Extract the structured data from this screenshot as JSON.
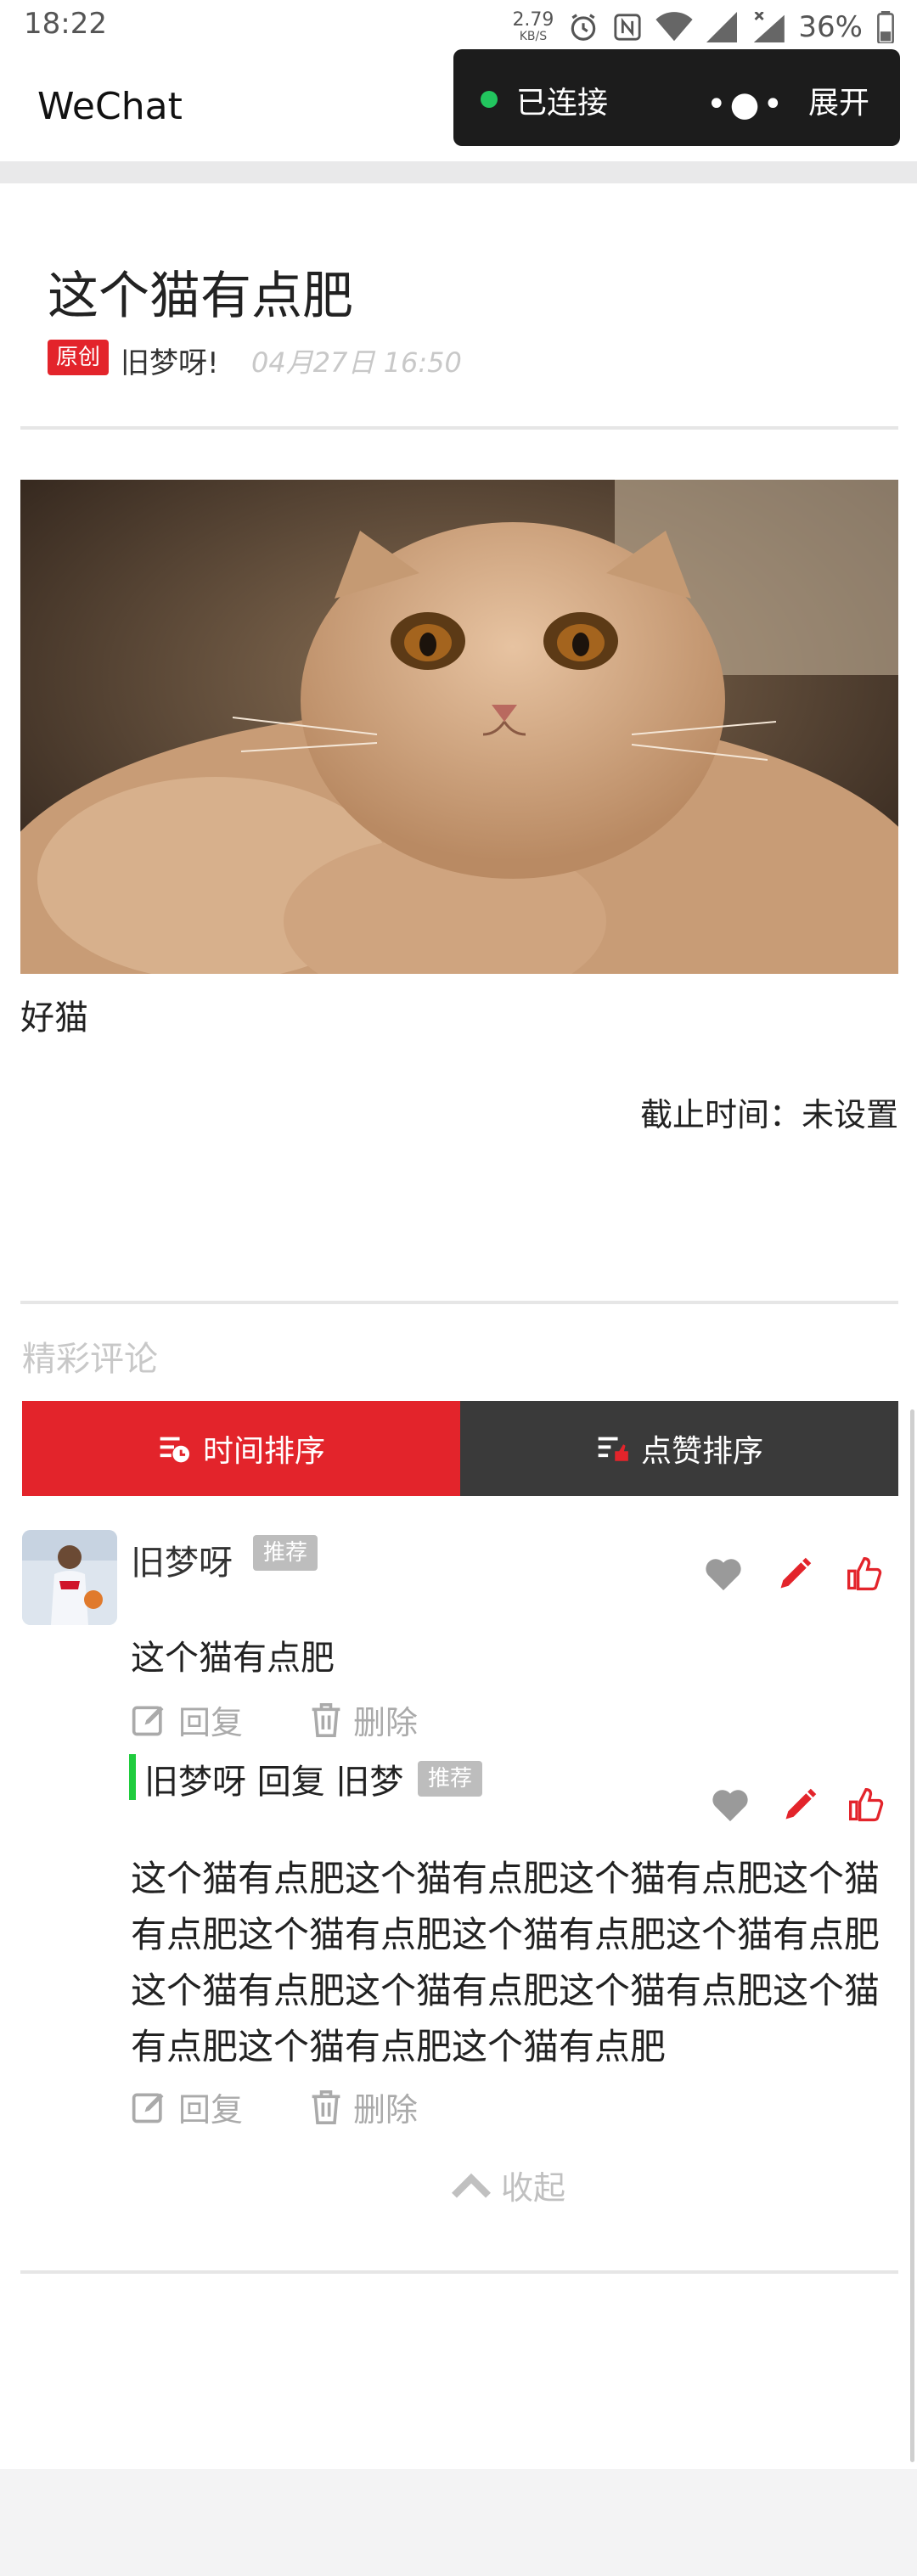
{
  "status_bar": {
    "time": "18:22",
    "net_speed_value": "2.79",
    "net_speed_unit": "KB/S",
    "battery": "36%",
    "icons": [
      "alarm-icon",
      "nfc-icon",
      "wifi-icon",
      "signal-icon",
      "signal-no-sim-icon",
      "battery-icon"
    ]
  },
  "nav": {
    "title": "WeChat",
    "capsule": {
      "status": "已连接",
      "expand_label": "展开",
      "status_color": "#22c55e"
    }
  },
  "article": {
    "title": "这个猫有点肥",
    "badge": "原创",
    "author": "旧梦呀!",
    "date": "04月27日 16:50",
    "caption": "好猫",
    "deadline": "截止时间：未设置"
  },
  "comments_section": {
    "title": "精彩评论",
    "tabs": [
      {
        "label": "时间排序",
        "active": true
      },
      {
        "label": "点赞排序",
        "active": false
      }
    ]
  },
  "comment": {
    "name": "旧梦呀",
    "tag": "推荐",
    "text": "这个猫有点肥",
    "reply_label": "回复",
    "delete_label": "删除",
    "icons": [
      "heart-icon",
      "pencil-icon",
      "thumbs-up-icon"
    ]
  },
  "reply": {
    "header": "旧梦呀 回复 旧梦",
    "tag": "推荐",
    "text": "这个猫有点肥这个猫有点肥这个猫有点肥这个猫有点肥这个猫有点肥这个猫有点肥这个猫有点肥这个猫有点肥这个猫有点肥这个猫有点肥这个猫有点肥这个猫有点肥这个猫有点肥",
    "reply_label": "回复",
    "delete_label": "删除"
  },
  "collapse_label": "收起",
  "colors": {
    "accent_red": "#e3242b",
    "dark_tab": "#3a3a3a",
    "reply_bar": "#1fcc3d"
  }
}
